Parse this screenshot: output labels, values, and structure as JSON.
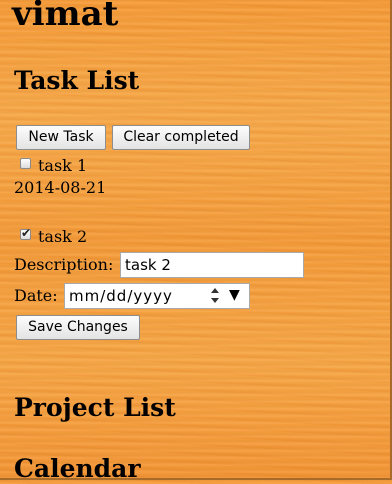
{
  "app": {
    "title": "vimat"
  },
  "sections": {
    "task_list": "Task List",
    "project_list": "Project List",
    "calendar": "Calendar"
  },
  "toolbar": {
    "new_task_label": "New Task",
    "clear_completed_label": "Clear completed"
  },
  "tasks": [
    {
      "name": "task 1",
      "checked": false,
      "date": "2014-08-21"
    },
    {
      "name": "task 2",
      "checked": true
    }
  ],
  "editor": {
    "description_label": "Description:",
    "description_value": "task 2",
    "date_label": "Date:",
    "date_placeholder": "mm/dd/yyyy",
    "save_label": "Save Changes"
  },
  "colors": {
    "background": "#f6a040"
  }
}
